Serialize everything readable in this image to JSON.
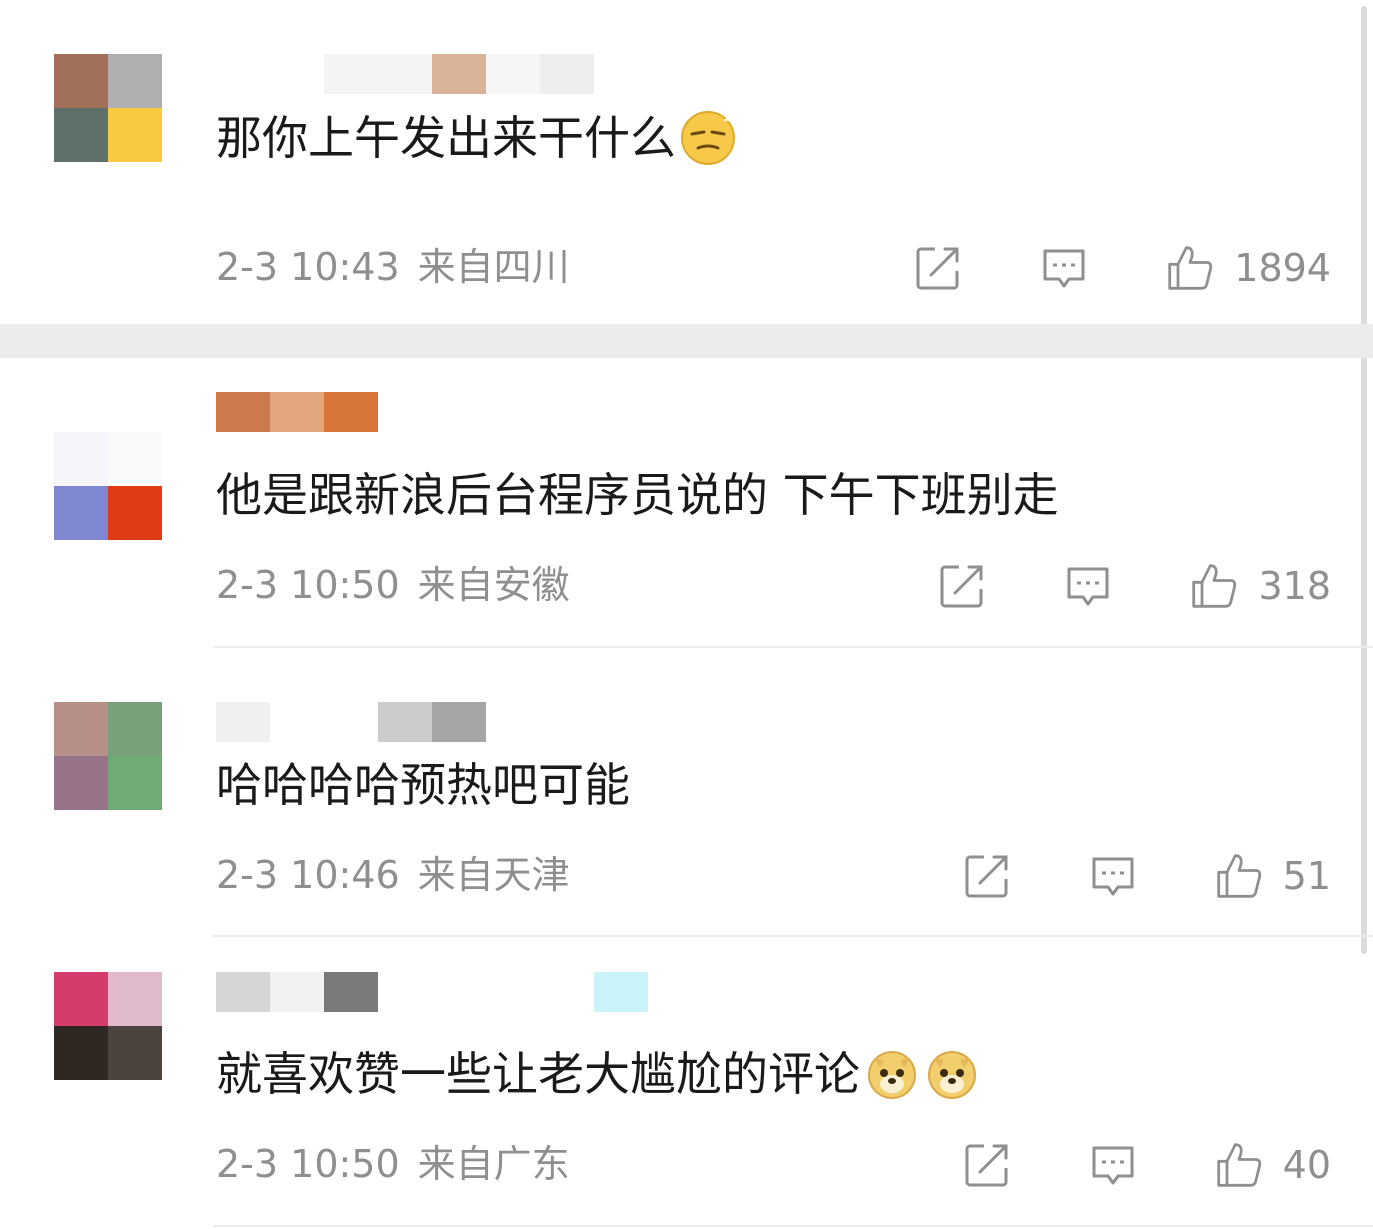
{
  "comments": [
    {
      "text": "那你上午发出来干什么",
      "time": "2-3 10:43",
      "location": "来自四川",
      "likes": "1894",
      "avatar_colors": [
        "#a0705a",
        "#b0aeae",
        "#5f706a",
        "#f6cb40"
      ],
      "username_colors": [
        "#ffffff",
        "#f4f4f4",
        "#d9b49a",
        "#f6f6f6",
        "#eeeeee",
        "#ffffff"
      ],
      "emoji": "smirk-emoji"
    },
    {
      "text": "他是跟新浪后台程序员说的 下午下班别走",
      "time": "2-3 10:50",
      "location": "来自安徽",
      "likes": "318",
      "avatar_colors": [
        "#f5f5fb",
        "#fafafa",
        "#7f86d2",
        "#e03a17"
      ],
      "username_colors": [
        "#cc7a4b",
        "#e3a77f",
        "#d87538"
      ],
      "emoji": ""
    },
    {
      "text": "哈哈哈哈预热吧可能",
      "time": "2-3 10:46",
      "location": "来自天津",
      "likes": "51",
      "avatar_colors": [
        "#b69087",
        "#78a07b",
        "#967389",
        "#6fab75"
      ],
      "username_colors": [
        "#f0f0f0",
        "#ffffff",
        "#ffffff",
        "#cccccc",
        "#a5a5a5"
      ],
      "emoji": ""
    },
    {
      "text": "就喜欢赞一些让老大尴尬的评论",
      "time": "2-3 10:50",
      "location": "来自广东",
      "likes": "40",
      "avatar_colors": [
        "#d33c6b",
        "#e0b9cb",
        "#2f2722",
        "#4b433c"
      ],
      "username_colors": [
        "#d6d6d6",
        "#f2f2f2",
        "#7a7a7a",
        "#ffffff",
        "#ffffff",
        "#ffffff",
        "#cbf4fa"
      ],
      "emoji": "doge-emoji"
    }
  ],
  "icons": {
    "share": "share-icon",
    "reply": "comment-icon",
    "like": "thumbs-up-icon"
  }
}
